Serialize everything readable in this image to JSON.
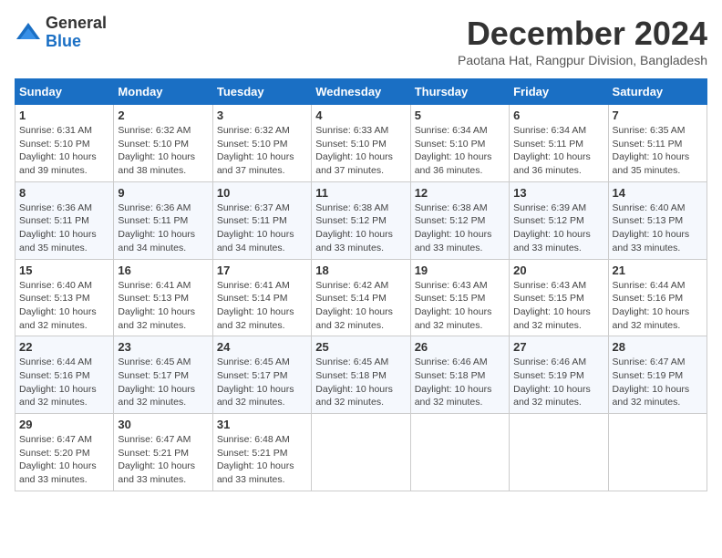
{
  "logo": {
    "general": "General",
    "blue": "Blue"
  },
  "title": "December 2024",
  "subtitle": "Paotana Hat, Rangpur Division, Bangladesh",
  "weekdays": [
    "Sunday",
    "Monday",
    "Tuesday",
    "Wednesday",
    "Thursday",
    "Friday",
    "Saturday"
  ],
  "weeks": [
    [
      {
        "day": "1",
        "info": "Sunrise: 6:31 AM\nSunset: 5:10 PM\nDaylight: 10 hours\nand 39 minutes."
      },
      {
        "day": "2",
        "info": "Sunrise: 6:32 AM\nSunset: 5:10 PM\nDaylight: 10 hours\nand 38 minutes."
      },
      {
        "day": "3",
        "info": "Sunrise: 6:32 AM\nSunset: 5:10 PM\nDaylight: 10 hours\nand 37 minutes."
      },
      {
        "day": "4",
        "info": "Sunrise: 6:33 AM\nSunset: 5:10 PM\nDaylight: 10 hours\nand 37 minutes."
      },
      {
        "day": "5",
        "info": "Sunrise: 6:34 AM\nSunset: 5:10 PM\nDaylight: 10 hours\nand 36 minutes."
      },
      {
        "day": "6",
        "info": "Sunrise: 6:34 AM\nSunset: 5:11 PM\nDaylight: 10 hours\nand 36 minutes."
      },
      {
        "day": "7",
        "info": "Sunrise: 6:35 AM\nSunset: 5:11 PM\nDaylight: 10 hours\nand 35 minutes."
      }
    ],
    [
      {
        "day": "8",
        "info": "Sunrise: 6:36 AM\nSunset: 5:11 PM\nDaylight: 10 hours\nand 35 minutes."
      },
      {
        "day": "9",
        "info": "Sunrise: 6:36 AM\nSunset: 5:11 PM\nDaylight: 10 hours\nand 34 minutes."
      },
      {
        "day": "10",
        "info": "Sunrise: 6:37 AM\nSunset: 5:11 PM\nDaylight: 10 hours\nand 34 minutes."
      },
      {
        "day": "11",
        "info": "Sunrise: 6:38 AM\nSunset: 5:12 PM\nDaylight: 10 hours\nand 33 minutes."
      },
      {
        "day": "12",
        "info": "Sunrise: 6:38 AM\nSunset: 5:12 PM\nDaylight: 10 hours\nand 33 minutes."
      },
      {
        "day": "13",
        "info": "Sunrise: 6:39 AM\nSunset: 5:12 PM\nDaylight: 10 hours\nand 33 minutes."
      },
      {
        "day": "14",
        "info": "Sunrise: 6:40 AM\nSunset: 5:13 PM\nDaylight: 10 hours\nand 33 minutes."
      }
    ],
    [
      {
        "day": "15",
        "info": "Sunrise: 6:40 AM\nSunset: 5:13 PM\nDaylight: 10 hours\nand 32 minutes."
      },
      {
        "day": "16",
        "info": "Sunrise: 6:41 AM\nSunset: 5:13 PM\nDaylight: 10 hours\nand 32 minutes."
      },
      {
        "day": "17",
        "info": "Sunrise: 6:41 AM\nSunset: 5:14 PM\nDaylight: 10 hours\nand 32 minutes."
      },
      {
        "day": "18",
        "info": "Sunrise: 6:42 AM\nSunset: 5:14 PM\nDaylight: 10 hours\nand 32 minutes."
      },
      {
        "day": "19",
        "info": "Sunrise: 6:43 AM\nSunset: 5:15 PM\nDaylight: 10 hours\nand 32 minutes."
      },
      {
        "day": "20",
        "info": "Sunrise: 6:43 AM\nSunset: 5:15 PM\nDaylight: 10 hours\nand 32 minutes."
      },
      {
        "day": "21",
        "info": "Sunrise: 6:44 AM\nSunset: 5:16 PM\nDaylight: 10 hours\nand 32 minutes."
      }
    ],
    [
      {
        "day": "22",
        "info": "Sunrise: 6:44 AM\nSunset: 5:16 PM\nDaylight: 10 hours\nand 32 minutes."
      },
      {
        "day": "23",
        "info": "Sunrise: 6:45 AM\nSunset: 5:17 PM\nDaylight: 10 hours\nand 32 minutes."
      },
      {
        "day": "24",
        "info": "Sunrise: 6:45 AM\nSunset: 5:17 PM\nDaylight: 10 hours\nand 32 minutes."
      },
      {
        "day": "25",
        "info": "Sunrise: 6:45 AM\nSunset: 5:18 PM\nDaylight: 10 hours\nand 32 minutes."
      },
      {
        "day": "26",
        "info": "Sunrise: 6:46 AM\nSunset: 5:18 PM\nDaylight: 10 hours\nand 32 minutes."
      },
      {
        "day": "27",
        "info": "Sunrise: 6:46 AM\nSunset: 5:19 PM\nDaylight: 10 hours\nand 32 minutes."
      },
      {
        "day": "28",
        "info": "Sunrise: 6:47 AM\nSunset: 5:19 PM\nDaylight: 10 hours\nand 32 minutes."
      }
    ],
    [
      {
        "day": "29",
        "info": "Sunrise: 6:47 AM\nSunset: 5:20 PM\nDaylight: 10 hours\nand 33 minutes."
      },
      {
        "day": "30",
        "info": "Sunrise: 6:47 AM\nSunset: 5:21 PM\nDaylight: 10 hours\nand 33 minutes."
      },
      {
        "day": "31",
        "info": "Sunrise: 6:48 AM\nSunset: 5:21 PM\nDaylight: 10 hours\nand 33 minutes."
      },
      null,
      null,
      null,
      null
    ]
  ]
}
